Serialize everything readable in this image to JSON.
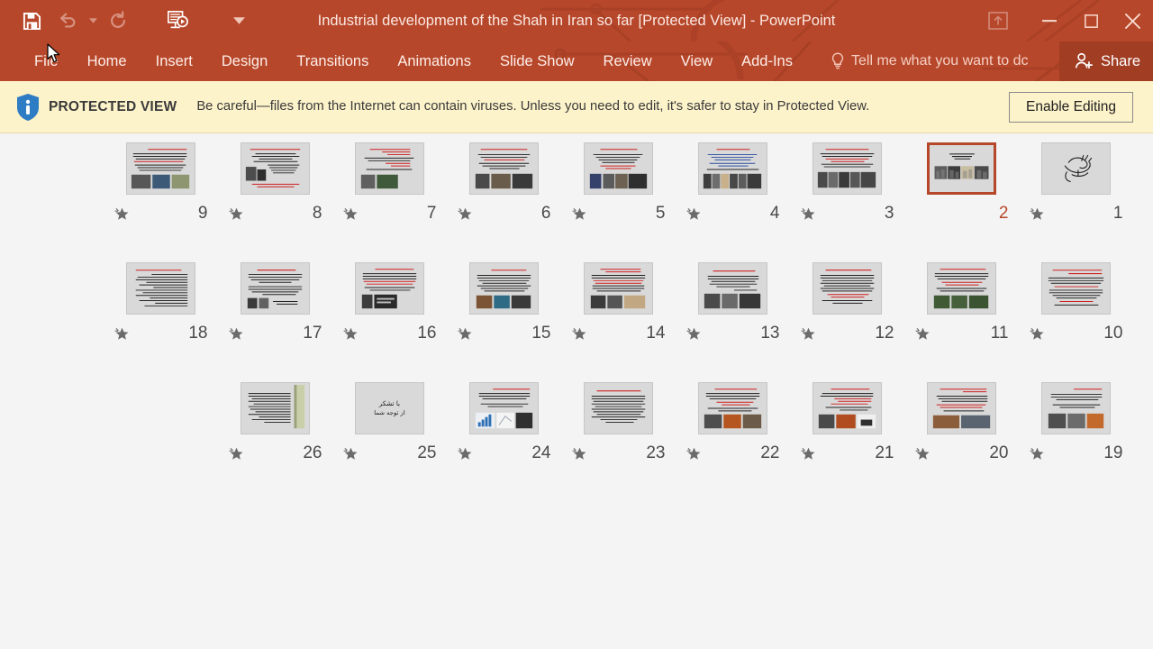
{
  "window": {
    "title": "Industrial development of the Shah in Iran so far [Protected View] - PowerPoint",
    "accent_color": "#b7472a",
    "share_bg": "#a03d23"
  },
  "quick_access": [
    {
      "name": "save",
      "label": "Save",
      "enabled": true
    },
    {
      "name": "undo",
      "label": "Undo",
      "enabled": false
    },
    {
      "name": "undo-dropdown",
      "label": "Undo options",
      "enabled": false
    },
    {
      "name": "redo",
      "label": "Repeat",
      "enabled": false
    },
    {
      "name": "start-from-beginning",
      "label": "Start From Beginning",
      "enabled": true
    },
    {
      "name": "customize-qat",
      "label": "Customize Quick Access Toolbar",
      "enabled": true
    }
  ],
  "window_controls": [
    {
      "name": "ribbon-display-options",
      "label": "Ribbon Display Options"
    },
    {
      "name": "minimize",
      "label": "Minimize"
    },
    {
      "name": "maximize",
      "label": "Maximize"
    },
    {
      "name": "close",
      "label": "Close"
    }
  ],
  "ribbon": {
    "tabs": [
      {
        "label": "File"
      },
      {
        "label": "Home"
      },
      {
        "label": "Insert"
      },
      {
        "label": "Design"
      },
      {
        "label": "Transitions"
      },
      {
        "label": "Animations"
      },
      {
        "label": "Slide Show"
      },
      {
        "label": "Review"
      },
      {
        "label": "View"
      },
      {
        "label": "Add-Ins"
      }
    ],
    "tell_me": "Tell me what you want to dc",
    "share_label": "Share"
  },
  "protected_view": {
    "badge": "PROTECTED VIEW",
    "message": "Be careful—files from the Internet can contain viruses. Unless you need to edit, it's safer to stay in Protected View.",
    "button": "Enable Editing",
    "background": "#fdf3ca"
  },
  "slide_sorter": {
    "selected_slide": 2,
    "rows": [
      [
        {
          "n": 9,
          "star": true,
          "kind": "text-photos-3"
        },
        {
          "n": 8,
          "star": true,
          "kind": "text-dense-photos"
        },
        {
          "n": 7,
          "star": true,
          "kind": "text-red-photos-2"
        },
        {
          "n": 6,
          "star": true,
          "kind": "text-photos-row"
        },
        {
          "n": 5,
          "star": true,
          "kind": "text-photos-4"
        },
        {
          "n": 4,
          "star": true,
          "kind": "text-blue-photos"
        },
        {
          "n": 3,
          "star": true,
          "kind": "text-crowd-photos"
        },
        {
          "n": 2,
          "star": false,
          "kind": "title-photos-band",
          "selected": true
        },
        {
          "n": 1,
          "star": true,
          "kind": "calligraphy"
        }
      ],
      [
        {
          "n": 18,
          "star": true,
          "kind": "text-only"
        },
        {
          "n": 17,
          "star": true,
          "kind": "text-photos-2"
        },
        {
          "n": 16,
          "star": true,
          "kind": "text-photos-dark"
        },
        {
          "n": 15,
          "star": true,
          "kind": "text-photos-color"
        },
        {
          "n": 14,
          "star": true,
          "kind": "text-photos-warm"
        },
        {
          "n": 13,
          "star": true,
          "kind": "text-bw-photos"
        },
        {
          "n": 12,
          "star": true,
          "kind": "text-only-red"
        },
        {
          "n": 11,
          "star": true,
          "kind": "text-photos-green"
        },
        {
          "n": 10,
          "star": true,
          "kind": "text-red-lines"
        }
      ],
      [
        {
          "n": 26,
          "star": true,
          "kind": "text-sidebar"
        },
        {
          "n": 25,
          "star": true,
          "kind": "thanks"
        },
        {
          "n": 24,
          "star": true,
          "kind": "chart-photos"
        },
        {
          "n": 23,
          "star": true,
          "kind": "text-only-plain"
        },
        {
          "n": 22,
          "star": true,
          "kind": "text-industry-photos"
        },
        {
          "n": 21,
          "star": true,
          "kind": "text-photos-mixed"
        },
        {
          "n": 20,
          "star": true,
          "kind": "text-wide-photo"
        },
        {
          "n": 19,
          "star": true,
          "kind": "text-photo-orange"
        }
      ]
    ],
    "star_icon": "star-icon",
    "thanks_text_line1": "با تشکر",
    "thanks_text_line2": "از توجه شما"
  }
}
